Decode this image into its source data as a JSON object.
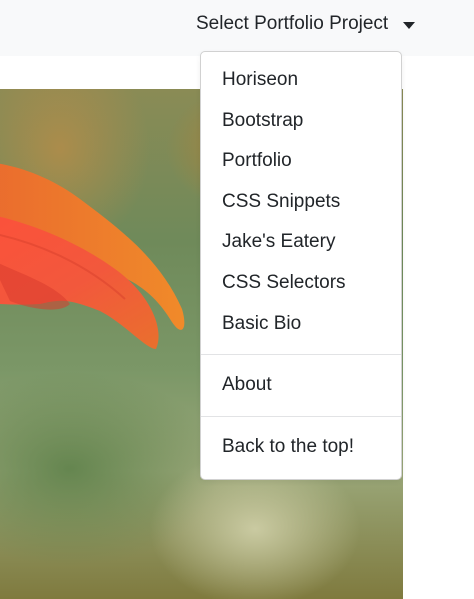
{
  "navbar": {
    "toggle_label": "Select Portfolio Project",
    "toggle_icon": "caret-down-icon"
  },
  "dropdown": {
    "projects": [
      "Horiseon",
      "Bootstrap",
      "Portfolio",
      "CSS Snippets",
      "Jake's Eatery",
      "CSS Selectors",
      "Basic Bio"
    ],
    "about_label": "About",
    "back_label": "Back to the top!"
  },
  "colors": {
    "navbar_bg": "#f8f9fa",
    "menu_text": "#212529",
    "petal": "#f0553c"
  }
}
